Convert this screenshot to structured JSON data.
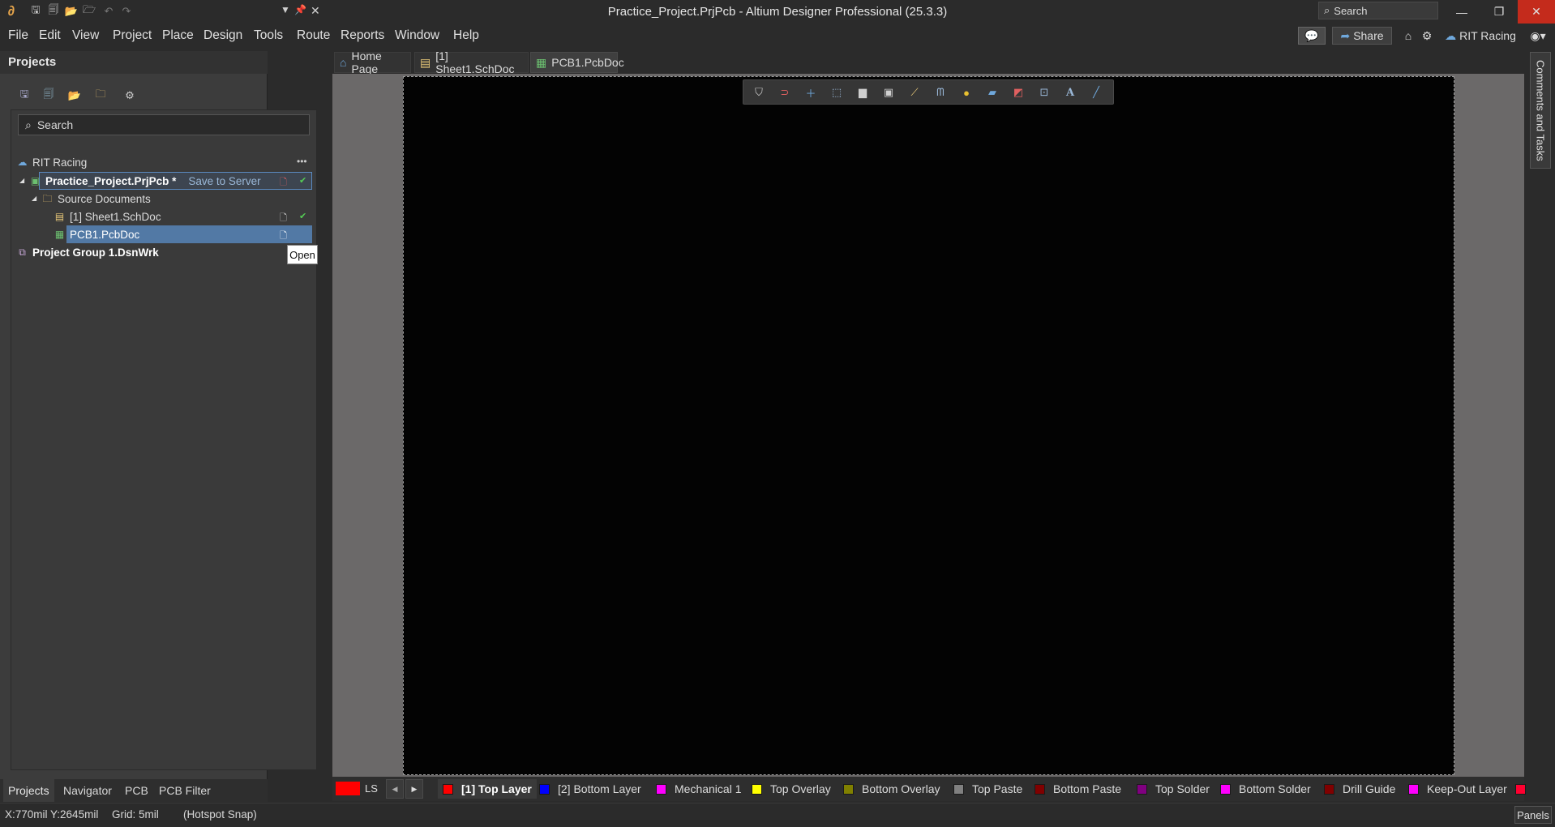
{
  "window": {
    "title": "Practice_Project.PrjPcb - Altium Designer Professional (25.3.3)",
    "search_placeholder": "Search",
    "minimize": "—",
    "restore": "❐",
    "close": "✕"
  },
  "menubar": {
    "items": [
      "File",
      "Edit",
      "View",
      "Project",
      "Place",
      "Design",
      "Tools",
      "Route",
      "Reports",
      "Window",
      "Help"
    ],
    "share_label": "Share",
    "workspace_label": "RIT Racing"
  },
  "projects_panel": {
    "title": "Projects",
    "search_placeholder": "Search",
    "workspace": "RIT Racing",
    "project": {
      "name": "Practice_Project.PrjPcb *",
      "action": "Save to Server"
    },
    "folder": "Source Documents",
    "documents": [
      "[1] Sheet1.SchDoc",
      "PCB1.PcbDoc"
    ],
    "group": "Project Group 1.DsnWrk",
    "tooltip": "Open",
    "more": "•••"
  },
  "panel_tabs": [
    "Projects",
    "Navigator",
    "PCB",
    "PCB Filter"
  ],
  "doc_tabs": [
    "Home Page",
    "[1] Sheet1.SchDoc",
    "PCB1.PcbDoc"
  ],
  "right_panel": {
    "comments_label": "Comments and Tasks"
  },
  "layer_bar": {
    "ls_label": "LS",
    "layers": [
      {
        "name": "[1] Top Layer",
        "color": "#ff0000",
        "active": true
      },
      {
        "name": "[2] Bottom Layer",
        "color": "#0000ff"
      },
      {
        "name": "Mechanical 1",
        "color": "#ff00ff"
      },
      {
        "name": "Top Overlay",
        "color": "#ffff00"
      },
      {
        "name": "Bottom Overlay",
        "color": "#808000"
      },
      {
        "name": "Top Paste",
        "color": "#808080"
      },
      {
        "name": "Bottom Paste",
        "color": "#800000"
      },
      {
        "name": "Top Solder",
        "color": "#800080"
      },
      {
        "name": "Bottom Solder",
        "color": "#ff00ff"
      },
      {
        "name": "Drill Guide",
        "color": "#800000"
      },
      {
        "name": "Keep-Out Layer",
        "color": "#ff00ff"
      }
    ]
  },
  "status": {
    "coords": "X:770mil Y:2645mil",
    "grid": "Grid: 5mil",
    "snap": "(Hotspot Snap)",
    "panels_button": "Panels"
  },
  "icons": {
    "pcb_toolbar": [
      "filter-icon",
      "route-magnet-icon",
      "plus-icon",
      "select-rect-icon",
      "bar-chart-icon",
      "component-icon",
      "interactive-route-icon",
      "differential-pair-icon",
      "via-icon",
      "polygon-icon",
      "keepout-icon",
      "dimension-icon",
      "text-icon",
      "line-icon"
    ]
  }
}
